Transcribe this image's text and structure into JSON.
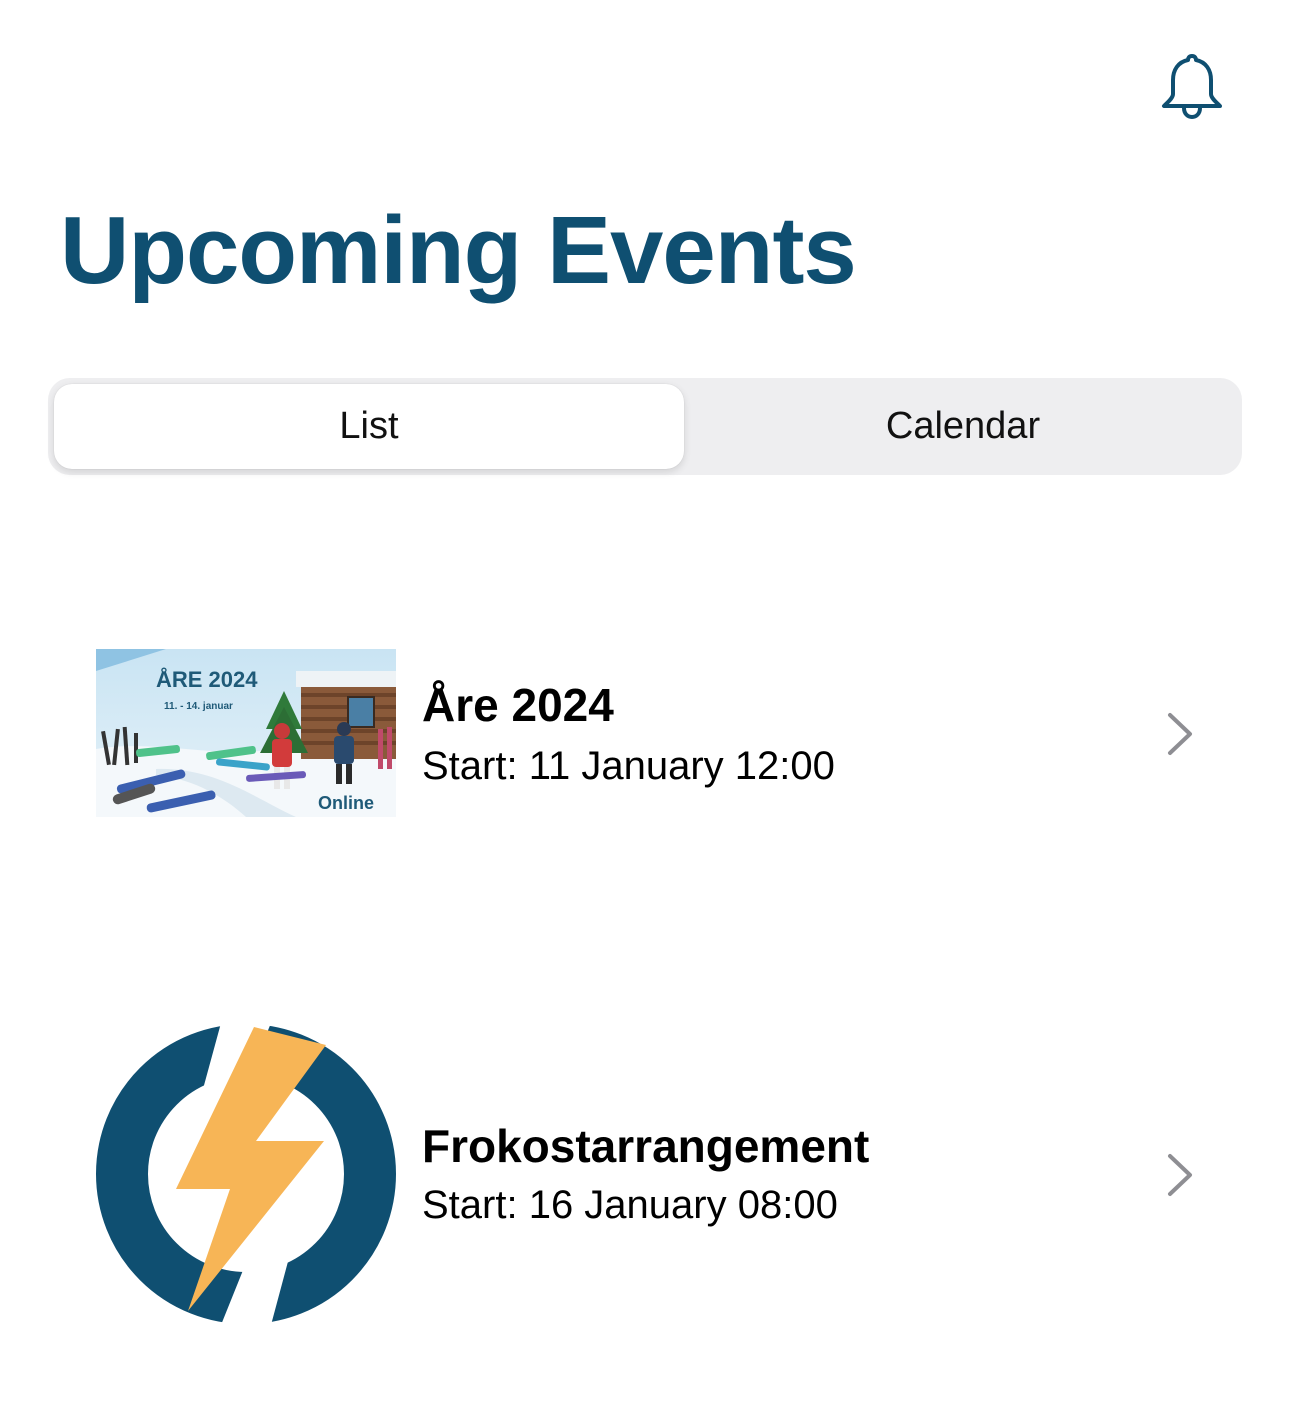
{
  "header": {
    "notifications_icon": "bell-icon",
    "title": "Upcoming Events",
    "accent_color": "#0f4f71"
  },
  "view_toggle": {
    "options": [
      "List",
      "Calendar"
    ],
    "selected": "List"
  },
  "events": [
    {
      "title": "Åre 2024",
      "start": "Start: 11 January 12:00",
      "thumbnail": {
        "heading": "ÅRE 2024",
        "dates": "11. - 14. januar",
        "brand": "Online"
      }
    },
    {
      "title": "Frokostarrangement",
      "start": "Start: 16 January 08:00",
      "thumbnail": {
        "icon": "power-lightning-logo",
        "ring_color": "#0f4f71",
        "bolt_color": "#f7b556"
      }
    }
  ],
  "row_icon": "chevron-right-icon"
}
